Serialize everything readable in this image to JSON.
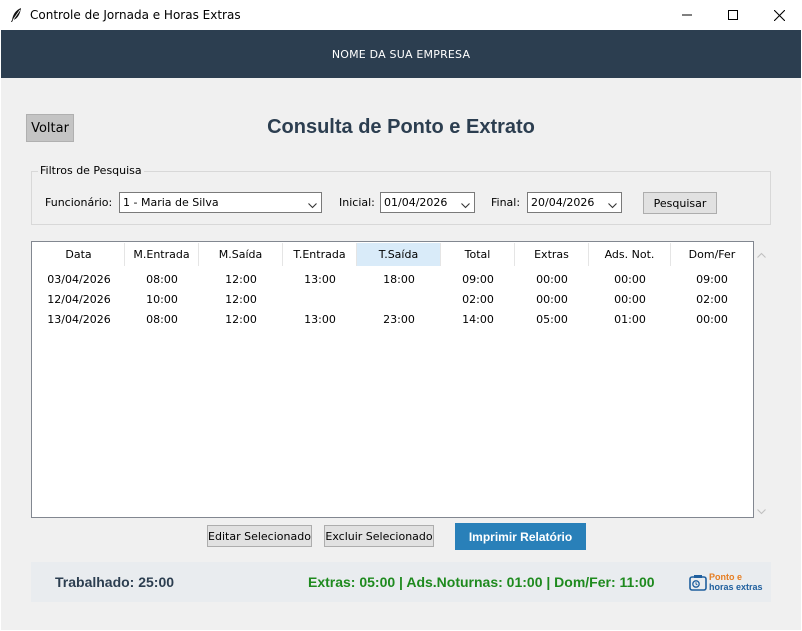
{
  "window": {
    "title": "Controle de Jornada e Horas Extras",
    "icons": [
      "feather-icon",
      "minimize-icon",
      "maximize-icon",
      "close-icon"
    ]
  },
  "banner": {
    "company": "NOME DA SUA EMPRESA"
  },
  "header": {
    "back_label": "Voltar",
    "title": "Consulta de Ponto e Extrato"
  },
  "filters": {
    "legend": "Filtros de Pesquisa",
    "employee_label": "Funcionário:",
    "employee_value": "1 - Maria de Silva",
    "start_label": "Inicial:",
    "start_value": "01/04/2026",
    "end_label": "Final:",
    "end_value": "20/04/2026",
    "search_label": "Pesquisar"
  },
  "table": {
    "columns": [
      "Data",
      "M.Entrada",
      "M.Saída",
      "T.Entrada",
      "T.Saída",
      "Total",
      "Extras",
      "Ads. Not.",
      "Dom/Fer"
    ],
    "sorted_column": "T.Saída",
    "rows": [
      [
        "03/04/2026",
        "08:00",
        "12:00",
        "13:00",
        "18:00",
        "09:00",
        "00:00",
        "00:00",
        "09:00"
      ],
      [
        "12/04/2026",
        "10:00",
        "12:00",
        "",
        "",
        "02:00",
        "00:00",
        "00:00",
        "02:00"
      ],
      [
        "13/04/2026",
        "08:00",
        "12:00",
        "13:00",
        "23:00",
        "14:00",
        "05:00",
        "01:00",
        "00:00"
      ]
    ]
  },
  "actions": {
    "edit_label": "Editar Selecionado",
    "delete_label": "Excluir Selecionado",
    "print_label": "Imprimir Relatório"
  },
  "summary": {
    "worked": "Trabalhado: 25:00",
    "extras": "Extras: 05:00 | Ads.Noturnas: 01:00 | Dom/Fer: 11:00"
  },
  "logo": {
    "line1": "Ponto e",
    "line2": "horas extras"
  },
  "colors": {
    "banner": "#2c3e50",
    "title": "#2c3e50",
    "print_button": "#2980b9",
    "extras_text": "#1e8a1e",
    "logo_orange": "#e67e22",
    "logo_blue": "#1f5f9e"
  }
}
